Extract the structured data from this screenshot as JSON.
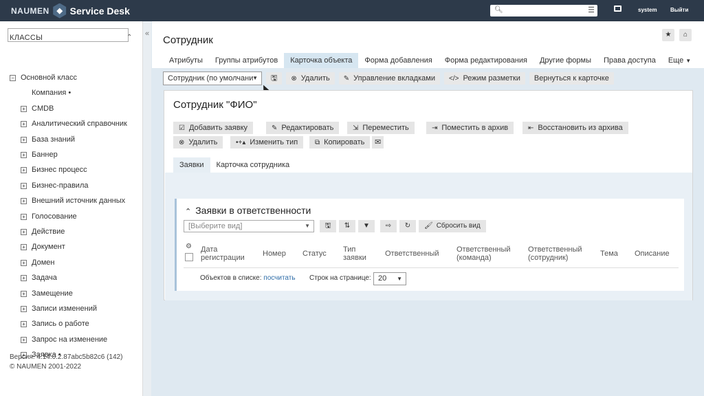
{
  "header": {
    "logo_brand": "NAUMEN",
    "logo_product": "Service Desk",
    "search_placeholder": "",
    "user": "system",
    "logout": "Выйти"
  },
  "sidebar": {
    "classes_label": "КЛАССЫ",
    "root": "Основной класс",
    "items": [
      {
        "label": "Компания •",
        "expandable": false
      },
      {
        "label": "CMDB",
        "expandable": true
      },
      {
        "label": "Аналитический справочник",
        "expandable": true
      },
      {
        "label": "База знаний",
        "expandable": true
      },
      {
        "label": "Баннер",
        "expandable": true
      },
      {
        "label": "Бизнес процесс",
        "expandable": true
      },
      {
        "label": "Бизнес-правила",
        "expandable": true
      },
      {
        "label": "Внешний источник данных",
        "expandable": true
      },
      {
        "label": "Голосование",
        "expandable": true
      },
      {
        "label": "Действие",
        "expandable": true
      },
      {
        "label": "Документ",
        "expandable": true
      },
      {
        "label": "Домен",
        "expandable": true
      },
      {
        "label": "Задача",
        "expandable": true
      },
      {
        "label": "Замещение",
        "expandable": true
      },
      {
        "label": "Записи изменений",
        "expandable": true
      },
      {
        "label": "Запись о работе",
        "expandable": true
      },
      {
        "label": "Запрос на изменение",
        "expandable": true
      },
      {
        "label": "Заявка •",
        "expandable": true
      }
    ],
    "version": "Версия: 4.14.0.2.87abc5b82c6 (142)",
    "copyright": "© NAUMEN 2001-2022"
  },
  "page": {
    "title": "Сотрудник",
    "tabs": [
      "Атрибуты",
      "Группы атрибутов",
      "Карточка объекта",
      "Форма добавления",
      "Форма редактирования",
      "Другие формы",
      "Права доступа",
      "Еще"
    ],
    "active_tab": "Карточка объекта",
    "toolbar": {
      "select_value": "Сотрудник (по умолчани",
      "delete": "Удалить",
      "manage_tabs": "Управление вкладками",
      "markup_mode": "Режим разметки",
      "back": "Вернуться к карточке"
    }
  },
  "card": {
    "title": "Сотрудник \"ФИО\"",
    "buttons": {
      "add_request": "Добавить заявку",
      "edit": "Редактировать",
      "move": "Переместить",
      "archive": "Поместить в архив",
      "restore": "Восстановить из архива",
      "delete": "Удалить",
      "change_type": "Изменить тип",
      "copy": "Копировать"
    },
    "tabs": [
      "Заявки",
      "Карточка сотрудника"
    ],
    "panel": {
      "title": "Заявки в ответственности",
      "view_placeholder": "[Выберите вид]",
      "reset_view": "Сбросить вид",
      "columns": [
        "Дата регистрации",
        "Номер",
        "Статус",
        "Тип заявки",
        "Ответственный",
        "Ответственный (команда)",
        "Ответственный (сотрудник)",
        "Тема",
        "Описание"
      ],
      "objects_label": "Объектов в списке:",
      "count_link": "посчитать",
      "rows_label": "Строк на странице:",
      "rows_value": "20"
    }
  }
}
